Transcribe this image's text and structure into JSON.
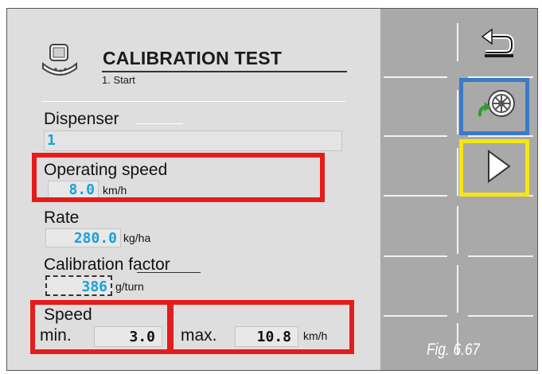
{
  "header": {
    "title": "CALIBRATION TEST",
    "subtitle": "1. Start",
    "icon": "calibration-test-icon"
  },
  "fields": {
    "dispenser": {
      "label": "Dispenser",
      "value": "1"
    },
    "operating_speed": {
      "label": "Operating speed",
      "value": "8.0",
      "unit": "km/h"
    },
    "rate": {
      "label": "Rate",
      "value": "280.0",
      "unit": "kg/ha"
    },
    "calibration_factor": {
      "label": "Calibration factor",
      "value": "386",
      "unit": "g/turn"
    },
    "speed": {
      "label": "Speed",
      "min_label": "min.",
      "min_value": "3.0",
      "max_label": "max.",
      "max_value": "10.8",
      "unit": "km/h"
    }
  },
  "softkeys": {
    "back": "back-arrow-icon",
    "wheel": "wheel-rotation-icon",
    "next": "play-next-icon"
  },
  "figure_caption": "Fig. 6.67",
  "colors": {
    "value_text": "#19a1d8",
    "highlight_red": "#e41c1c",
    "highlight_blue": "#3a7ac6",
    "highlight_yellow": "#f5e614",
    "softkey_bar": "#a9a9a9"
  }
}
